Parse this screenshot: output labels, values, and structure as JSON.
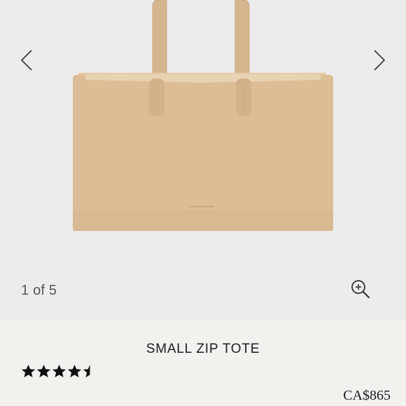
{
  "gallery": {
    "counter_text": "1 of 5",
    "current_index": 1,
    "total_images": 5,
    "prev_icon": "chevron-left-icon",
    "next_icon": "chevron-right-icon",
    "zoom_icon": "zoom-in-icon",
    "bag_color": "#dcbd95"
  },
  "product": {
    "title": "SMALL ZIP TOTE",
    "rating": 4.5,
    "rating_max": 5,
    "price": "CA$865"
  }
}
